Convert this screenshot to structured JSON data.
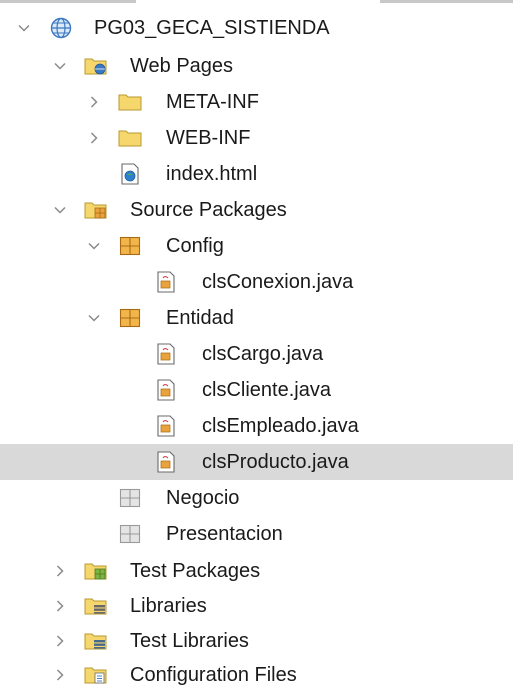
{
  "tree": {
    "project": {
      "label": "PG03_GECA_SISTIENDA",
      "icon": "web-project-globe-icon"
    },
    "web_pages": {
      "label": "Web Pages",
      "icon": "web-pages-folder-icon"
    },
    "meta_inf": {
      "label": "META-INF",
      "icon": "folder-icon"
    },
    "web_inf": {
      "label": "WEB-INF",
      "icon": "folder-icon"
    },
    "index_html": {
      "label": "index.html",
      "icon": "html-file-icon"
    },
    "source_packages": {
      "label": "Source Packages",
      "icon": "source-packages-icon"
    },
    "config": {
      "label": "Config",
      "icon": "package-icon"
    },
    "cls_conexion": {
      "label": "clsConexion.java",
      "icon": "java-file-icon"
    },
    "entidad": {
      "label": "Entidad",
      "icon": "package-icon"
    },
    "cls_cargo": {
      "label": "clsCargo.java",
      "icon": "java-file-icon"
    },
    "cls_cliente": {
      "label": "clsCliente.java",
      "icon": "java-file-icon"
    },
    "cls_empleado": {
      "label": "clsEmpleado.java",
      "icon": "java-file-icon"
    },
    "cls_producto": {
      "label": "clsProducto.java",
      "icon": "java-file-icon",
      "selected": true
    },
    "negocio": {
      "label": "Negocio",
      "icon": "empty-package-icon"
    },
    "presentacion": {
      "label": "Presentacion",
      "icon": "empty-package-icon"
    },
    "test_packages": {
      "label": "Test Packages",
      "icon": "test-packages-icon"
    },
    "libraries": {
      "label": "Libraries",
      "icon": "libraries-icon"
    },
    "test_libraries": {
      "label": "Test Libraries",
      "icon": "test-libraries-icon"
    },
    "configuration_files": {
      "label": "Configuration Files",
      "icon": "configuration-files-icon"
    }
  },
  "colors": {
    "selection_bg": "#d9d9d9",
    "folder_yellow": "#f5d76e",
    "package_orange": "#e8a33d",
    "chevron": "#8a8a8a",
    "globe_blue": "#3a78c2"
  }
}
